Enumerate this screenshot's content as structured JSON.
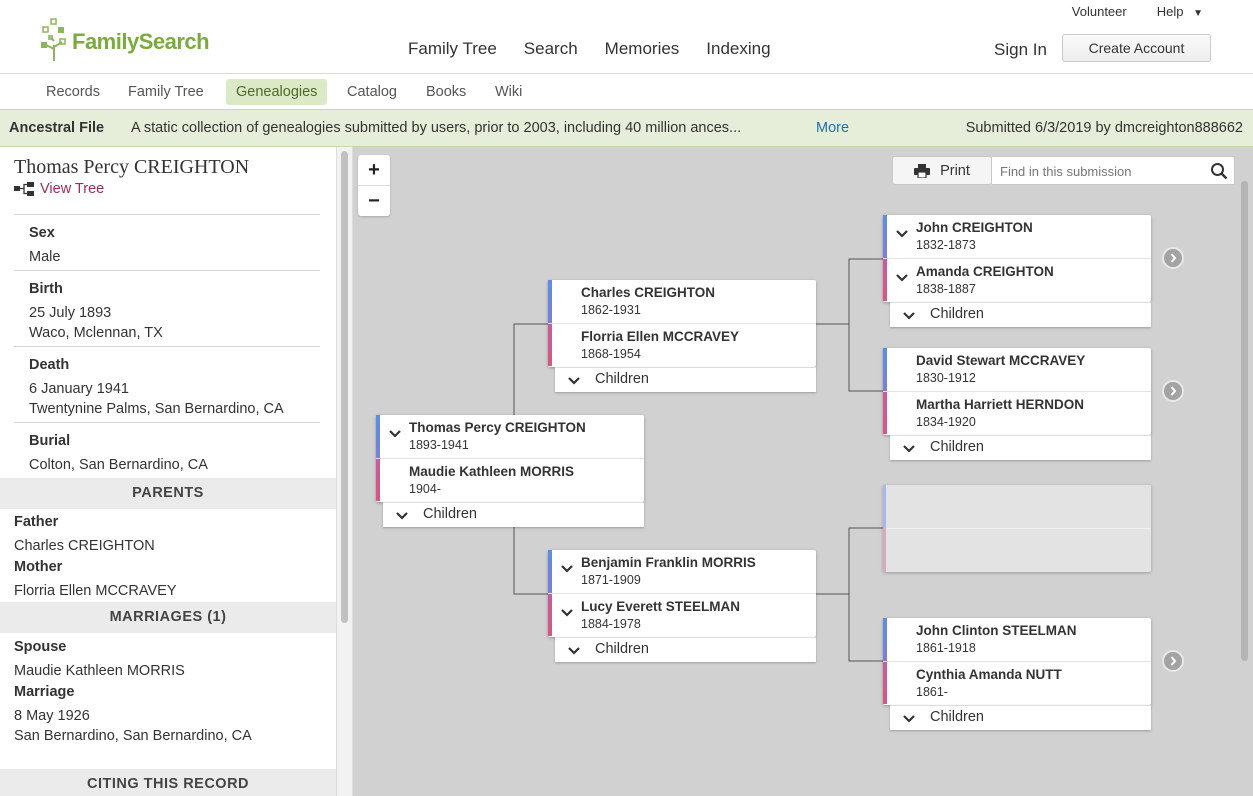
{
  "header": {
    "logo_text": "FamilySearch",
    "nav": [
      "Family Tree",
      "Search",
      "Memories",
      "Indexing"
    ],
    "volunteer": "Volunteer",
    "help": "Help",
    "help_caret": "▼",
    "sign_in": "Sign In",
    "create_account": "Create Account"
  },
  "subnav": {
    "items": [
      "Records",
      "Family Tree",
      "Genealogies",
      "Catalog",
      "Books",
      "Wiki"
    ],
    "active": "Genealogies"
  },
  "banner": {
    "title": "Ancestral File",
    "description": "A static collection of genealogies submitted by users, prior to 2003, including 40 million ances...",
    "more": "More",
    "submitted": "Submitted 6/3/2019 by dmcreighton888662"
  },
  "person": {
    "name": "Thomas Percy CREIGHTON",
    "view_tree": "View Tree",
    "facts": [
      {
        "label": "Sex",
        "lines": [
          "Male"
        ]
      },
      {
        "label": "Birth",
        "lines": [
          "25 July 1893",
          "Waco, Mclennan, TX"
        ]
      },
      {
        "label": "Death",
        "lines": [
          "6 January 1941",
          "Twentynine Palms, San Bernardino, CA"
        ]
      },
      {
        "label": "Burial",
        "lines": [
          "Colton, San Bernardino, CA"
        ]
      }
    ]
  },
  "parents": {
    "heading": "PARENTS",
    "father_label": "Father",
    "father": "Charles CREIGHTON",
    "mother_label": "Mother",
    "mother": "Florria Ellen MCCRAVEY"
  },
  "marriages": {
    "heading": "MARRIAGES (1)",
    "spouse_label": "Spouse",
    "spouse": "Maudie Kathleen MORRIS",
    "marriage_label": "Marriage",
    "marriage_date": "8 May 1926",
    "marriage_place": "San Bernardino, San Bernardino, CA"
  },
  "citing": {
    "heading": "CITING THIS RECORD"
  },
  "tree": {
    "print": "Print",
    "find_placeholder": "Find in this submission",
    "zoom_in": "+",
    "zoom_out": "−",
    "children_label": "Children",
    "couples": {
      "root": {
        "husband": "Thomas Percy CREIGHTON",
        "husband_dates": "1893-1941",
        "wife": "Maudie Kathleen MORRIS",
        "wife_dates": "1904-"
      },
      "father": {
        "husband": "Charles CREIGHTON",
        "husband_dates": "1862-1931",
        "wife": "Florria Ellen MCCRAVEY",
        "wife_dates": "1868-1954"
      },
      "mother": {
        "husband": "Benjamin Franklin MORRIS",
        "husband_dates": "1871-1909",
        "wife": "Lucy Everett STEELMAN",
        "wife_dates": "1884-1978"
      },
      "gp1": {
        "husband": "John CREIGHTON",
        "husband_dates": "1832-1873",
        "wife": "Amanda CREIGHTON",
        "wife_dates": "1838-1887"
      },
      "gp2": {
        "husband": "David Stewart MCCRAVEY",
        "husband_dates": "1830-1912",
        "wife": "Martha Harriett HERNDON",
        "wife_dates": "1834-1920"
      },
      "gp4": {
        "husband": "John Clinton STEELMAN",
        "husband_dates": "1861-1918",
        "wife": "Cynthia Amanda NUTT",
        "wife_dates": "1861-"
      }
    }
  },
  "colors": {
    "brand_green": "#7bab3d",
    "active_tab_bg": "#dce9c6",
    "banner_bg": "#e6edd8",
    "link_blue": "#1e6fb5",
    "view_tree_magenta": "#9c2c5d",
    "male_bar": "#5b8de8",
    "female_bar": "#d9567f",
    "tree_bg": "#d1d1d1"
  },
  "icons": [
    "tree-icon",
    "print-icon",
    "search-icon",
    "chevron-down-icon",
    "chevron-right-icon",
    "logo-icon"
  ]
}
